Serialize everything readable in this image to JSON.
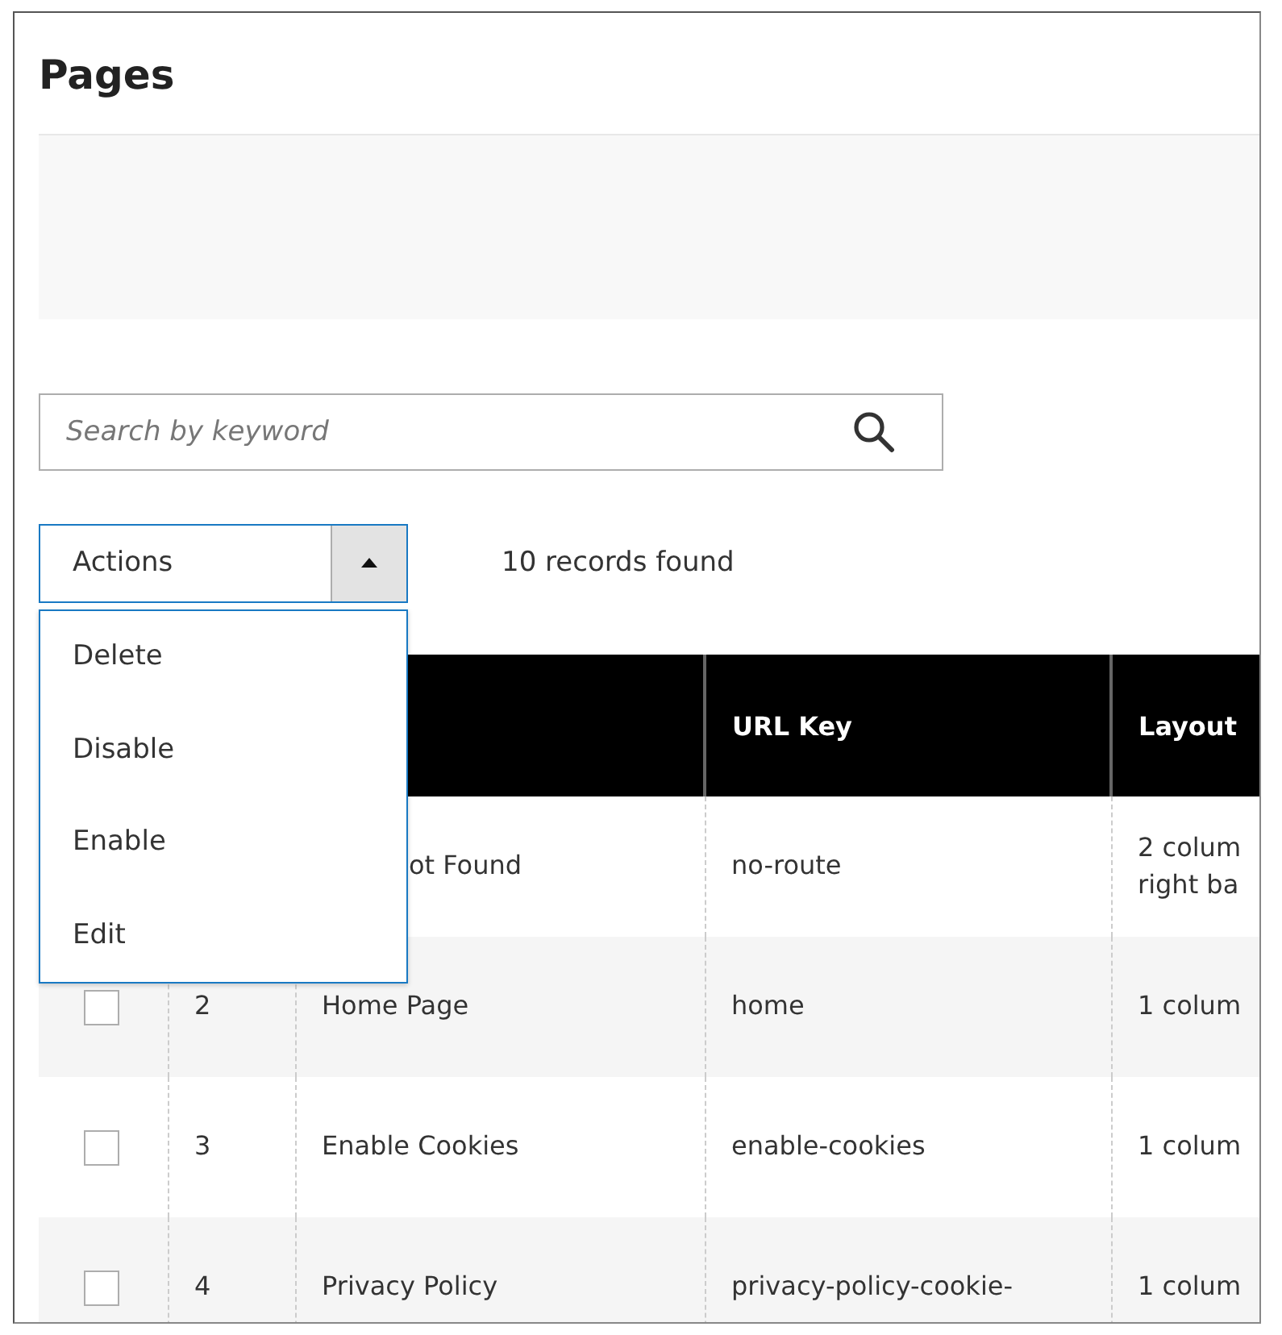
{
  "title": "Pages",
  "search": {
    "placeholder": "Search by keyword"
  },
  "actions": {
    "label": "Actions",
    "expanded": true,
    "menu": [
      "Delete",
      "Disable",
      "Enable",
      "Edit"
    ]
  },
  "records": "10 records found",
  "table": {
    "columns": [
      "URL Key",
      "Layout"
    ],
    "rows": [
      {
        "title": "ot Found",
        "url_key": [
          "no-route"
        ],
        "layout": [
          "2 colum",
          "right ba"
        ]
      },
      {
        "checked": false,
        "id": "2",
        "title": "Home Page",
        "url_key": [
          "home"
        ],
        "layout": [
          "1 colum"
        ]
      },
      {
        "checked": false,
        "id": "3",
        "title": "Enable Cookies",
        "url_key": [
          "enable-cookies"
        ],
        "layout": [
          "1 colum"
        ]
      },
      {
        "checked": false,
        "id": "4",
        "title": "Privacy Policy",
        "url_key": [
          "privacy-policy-cookie-"
        ],
        "layout": [
          "1 colum"
        ]
      }
    ]
  }
}
